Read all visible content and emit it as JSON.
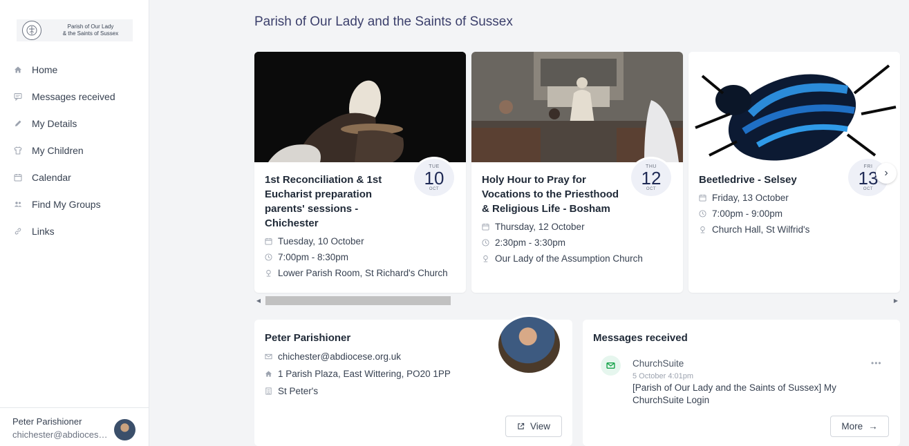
{
  "sidebar": {
    "logo_line1": "Parish of Our Lady",
    "logo_line2": "& the Saints of Sussex",
    "items": [
      {
        "label": "Home",
        "icon": "home-icon"
      },
      {
        "label": "Messages received",
        "icon": "message-icon"
      },
      {
        "label": "My Details",
        "icon": "pencil-icon"
      },
      {
        "label": "My Children",
        "icon": "shirt-icon"
      },
      {
        "label": "Calendar",
        "icon": "calendar-icon"
      },
      {
        "label": "Find My Groups",
        "icon": "people-icon"
      },
      {
        "label": "Links",
        "icon": "link-icon"
      }
    ],
    "user_name": "Peter Parishioner",
    "user_email": "chichester@abdiocese.org.uk"
  },
  "main": {
    "title": "Parish of Our Lady and the Saints of Sussex"
  },
  "events": [
    {
      "title": "1st Reconciliation & 1st Eucharist preparation parents' sessions - Chichester",
      "date_text": "Tuesday, 10 October",
      "time_text": "7:00pm - 8:30pm",
      "location": "Lower Parish Room, St Richard's Church",
      "badge_dow": "TUE",
      "badge_day": "10",
      "badge_mon": "OCT"
    },
    {
      "title": "Holy Hour to Pray for Vocations to the Priesthood & Religious Life - Bosham",
      "date_text": "Thursday, 12 October",
      "time_text": "2:30pm - 3:30pm",
      "location": "Our Lady of the Assumption Church",
      "badge_dow": "THU",
      "badge_day": "12",
      "badge_mon": "OCT"
    },
    {
      "title": "Beetledrive - Selsey",
      "date_text": "Friday, 13 October",
      "time_text": "7:00pm - 9:00pm",
      "location": "Church Hall, St Wilfrid's",
      "badge_dow": "FRI",
      "badge_day": "13",
      "badge_mon": "OCT"
    }
  ],
  "profile": {
    "name": "Peter Parishioner",
    "email": "chichester@abdiocese.org.uk",
    "address": "1 Parish Plaza, East Wittering, PO20 1PP",
    "church": "St Peter's",
    "view_label": "View"
  },
  "messages": {
    "title": "Messages received",
    "sender": "ChurchSuite",
    "time": "5 October 4:01pm",
    "subject": "[Parish of Our Lady and the Saints of Sussex] My ChurchSuite Login",
    "more_label": "More"
  },
  "colors": {
    "accent": "#3b3f6b",
    "badge_bg": "#eef0f7",
    "message_icon": "#16a34a"
  }
}
